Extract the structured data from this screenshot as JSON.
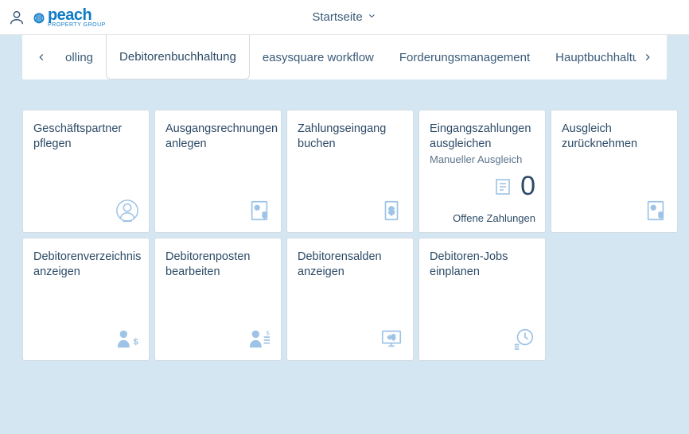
{
  "header": {
    "brand_name": "peach",
    "brand_sub": "PROPERTY GROUP",
    "nav_label": "Startseite"
  },
  "tabs": {
    "prev_partial": "olling",
    "items": [
      {
        "label": "Debitorenbuchhaltung",
        "active": true
      },
      {
        "label": "easysquare workflow",
        "active": false
      },
      {
        "label": "Forderungsmanagement",
        "active": false
      }
    ],
    "next_partial": "Hauptbuchhaltu"
  },
  "tiles": [
    {
      "title": "Geschäftspartner pflegen",
      "subtitle": "",
      "icon": "bp"
    },
    {
      "title": "Ausgangsrechnungen anlegen",
      "subtitle": "",
      "icon": "invoice"
    },
    {
      "title": "Zahlungseingang buchen",
      "subtitle": "",
      "icon": "dollar-doc"
    },
    {
      "title": "Eingangszahlungen ausgleichen",
      "subtitle": "Manueller Ausgleich",
      "icon": "",
      "kpi": "0",
      "kpi_icon": "receipt",
      "footer": "Offene Zahlungen"
    },
    {
      "title": "Ausgleich zurücknehmen",
      "subtitle": "",
      "icon": "invoice"
    },
    {
      "title": "Debitorenverzeichnis anzeigen",
      "subtitle": "",
      "icon": "person-dollar"
    },
    {
      "title": "Debitorenposten bearbeiten",
      "subtitle": "",
      "icon": "person-list"
    },
    {
      "title": "Debitorensalden anzeigen",
      "subtitle": "",
      "icon": "monitor-plus"
    },
    {
      "title": "Debitoren-Jobs einplanen",
      "subtitle": "",
      "icon": "clock-list"
    }
  ]
}
